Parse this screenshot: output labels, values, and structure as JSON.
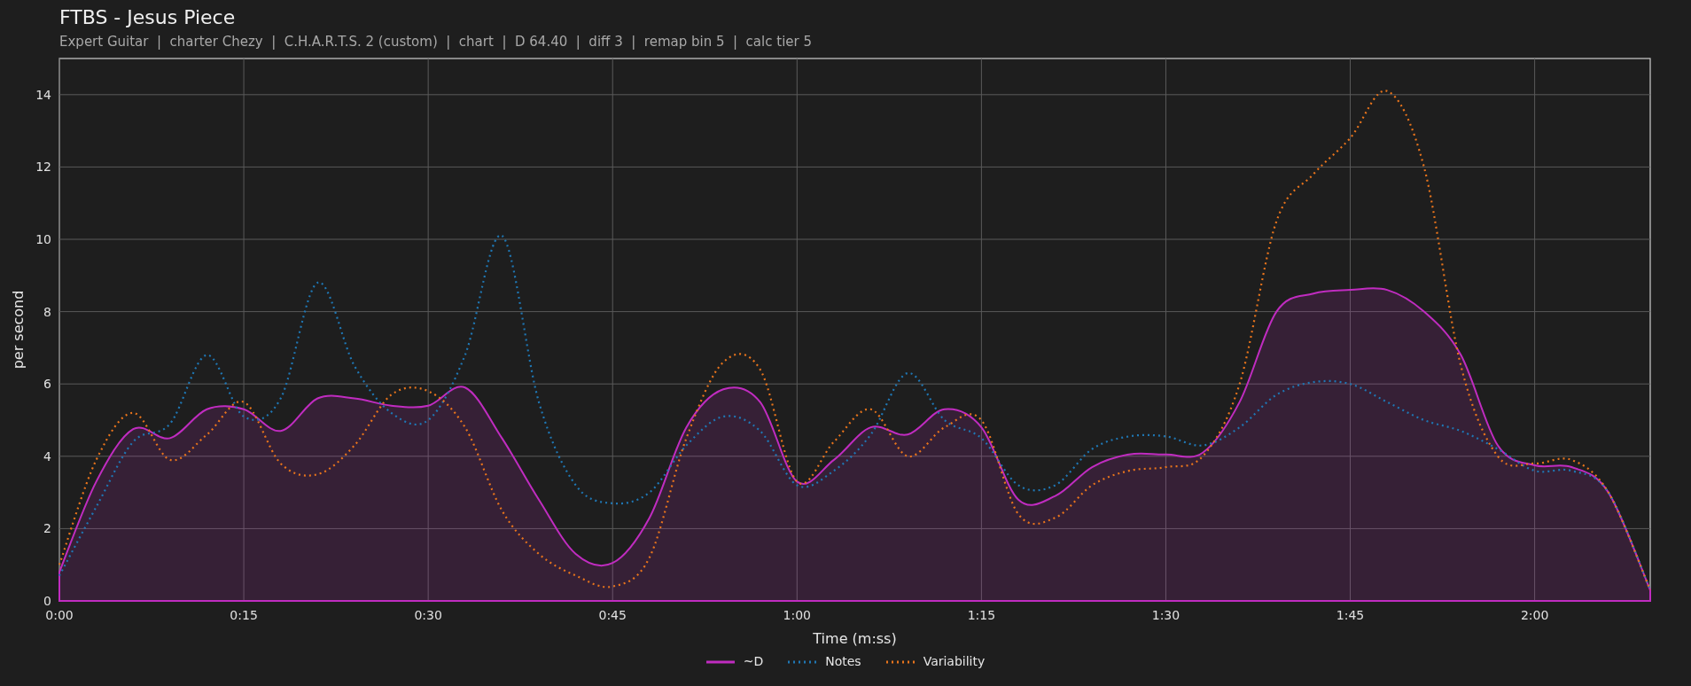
{
  "title": "FTBS - Jesus Piece",
  "subtitle": "Expert Guitar  |  charter Chezy  |  C.H.A.R.T.S. 2 (custom)  |  chart  |  D 64.40  |  diff 3  |  remap bin 5  |  calc tier 5",
  "chart_data": {
    "type": "line",
    "xlabel": "Time (m:ss)",
    "ylabel": "per second",
    "x": [
      0,
      3,
      6,
      9,
      12,
      15,
      18,
      21,
      24,
      27,
      30,
      33,
      36,
      39,
      42,
      45,
      48,
      51,
      54,
      57,
      60,
      63,
      66,
      69,
      72,
      75,
      78,
      81,
      84,
      87,
      90,
      93,
      96,
      99,
      102,
      105,
      108,
      111,
      114,
      117,
      120,
      123,
      126,
      129.4
    ],
    "series": [
      {
        "name": "~D",
        "color": "#c02cc0",
        "type": "area",
        "values": [
          0.8,
          3.3,
          4.75,
          4.5,
          5.3,
          5.3,
          4.7,
          5.6,
          5.6,
          5.4,
          5.4,
          5.9,
          4.5,
          2.8,
          1.3,
          1.05,
          2.3,
          4.8,
          5.85,
          5.5,
          3.3,
          3.9,
          4.8,
          4.6,
          5.3,
          4.8,
          2.8,
          2.9,
          3.7,
          4.05,
          4.05,
          4.1,
          5.5,
          8.0,
          8.5,
          8.6,
          8.6,
          8.0,
          6.8,
          4.3,
          3.75,
          3.7,
          3.0,
          0.3
        ]
      },
      {
        "name": "Notes",
        "color": "#1f77b4",
        "type": "line",
        "line_style": "dotted",
        "values": [
          0.7,
          2.6,
          4.4,
          4.9,
          6.8,
          5.1,
          5.6,
          8.8,
          6.5,
          5.2,
          5.0,
          6.8,
          10.1,
          5.5,
          3.2,
          2.7,
          3.0,
          4.3,
          5.1,
          4.7,
          3.2,
          3.6,
          4.6,
          6.3,
          5.0,
          4.5,
          3.2,
          3.2,
          4.2,
          4.55,
          4.55,
          4.3,
          4.8,
          5.7,
          6.05,
          6.0,
          5.5,
          5.0,
          4.7,
          4.2,
          3.6,
          3.6,
          3.0,
          0.3
        ]
      },
      {
        "name": "Variability",
        "color": "#e8741c",
        "type": "line",
        "line_style": "dotted",
        "values": [
          1.0,
          3.9,
          5.2,
          3.9,
          4.6,
          5.5,
          3.8,
          3.5,
          4.3,
          5.7,
          5.8,
          4.8,
          2.5,
          1.3,
          0.7,
          0.4,
          1.2,
          4.5,
          6.6,
          6.4,
          3.3,
          4.4,
          5.3,
          4.0,
          4.8,
          5.0,
          2.4,
          2.3,
          3.2,
          3.6,
          3.7,
          4.0,
          6.0,
          10.5,
          11.8,
          12.8,
          14.1,
          12.0,
          6.5,
          4.0,
          3.8,
          3.9,
          3.0,
          0.3
        ]
      }
    ],
    "grid": true,
    "xlim": [
      0,
      129.4
    ],
    "ylim": [
      0,
      15
    ],
    "xticks": [
      {
        "value": 0,
        "label": "0:00"
      },
      {
        "value": 15,
        "label": "0:15"
      },
      {
        "value": 30,
        "label": "0:30"
      },
      {
        "value": 45,
        "label": "0:45"
      },
      {
        "value": 60,
        "label": "1:00"
      },
      {
        "value": 75,
        "label": "1:15"
      },
      {
        "value": 90,
        "label": "1:30"
      },
      {
        "value": 105,
        "label": "1:45"
      },
      {
        "value": 120,
        "label": "2:00"
      }
    ],
    "yticks": [
      0,
      2,
      4,
      6,
      8,
      10,
      12,
      14
    ]
  }
}
